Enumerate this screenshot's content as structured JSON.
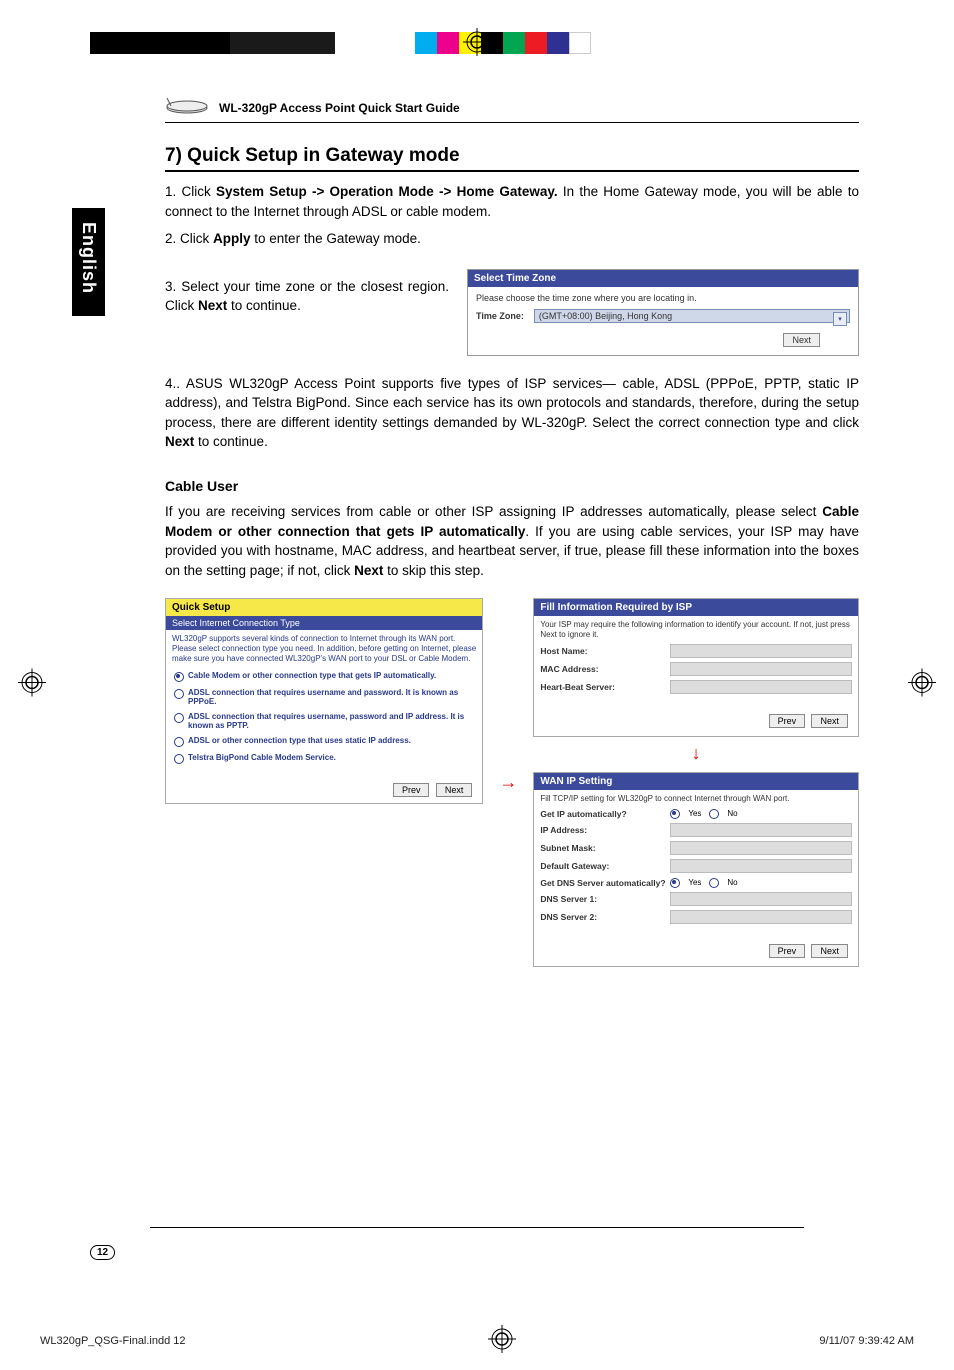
{
  "header": {
    "guide_title": "WL-320gP Access Point Quick Start Guide"
  },
  "side_tab": "English",
  "section_title": "7) Quick Setup in Gateway mode",
  "step1_prefix": "1. Click ",
  "step1_bold": "System Setup -> Operation Mode -> Home Gateway.",
  "step1_suffix": " In the Home Gateway mode, you will be able to connect to the Internet through ADSL or cable modem.",
  "step2_prefix": "2. Click ",
  "step2_bold": "Apply",
  "step2_suffix": " to enter the Gateway mode.",
  "step3_prefix": "3. Select your time zone or the closest region. Click ",
  "step3_bold": "Next",
  "step3_suffix": " to continue.",
  "tz_panel": {
    "title": "Select Time Zone",
    "desc": "Please choose the time zone where you are locating in.",
    "label": "Time Zone:",
    "value": "(GMT+08:00) Beijing, Hong Kong",
    "next": "Next"
  },
  "step4": "4.. ASUS WL320gP Access Point supports five types of ISP services— cable, ADSL (PPPoE, PPTP, static IP address), and Telstra BigPond. Since each service has its own protocols and standards, therefore, during the setup process, there are different identity settings demanded by WL-320gP. Select the correct connection type and click ",
  "step4_bold": "Next",
  "step4_suffix": " to continue.",
  "cable_heading": "Cable User",
  "cable_p_prefix": "If you are receiving services from cable or other ISP assigning IP addresses automatically, please select ",
  "cable_p_bold": "Cable Modem or other connection that gets IP automatically",
  "cable_p_mid": ". If you are using cable services, your ISP may have provided you with hostname, MAC address, and heartbeat server, if true, please fill these information into the boxes on the setting page; if not, click ",
  "cable_p_bold2": "Next",
  "cable_p_suffix": " to skip this step.",
  "quick_setup": {
    "title": "Quick Setup",
    "subtitle": "Select Internet Connection Type",
    "desc": "WL320gP supports several kinds of connection to Internet through its WAN port. Please select connection type you need. In addition, before getting on Internet, please make sure you have connected WL320gP's WAN port to your DSL or Cable Modem.",
    "options": [
      "Cable Modem or other connection type that gets IP automatically.",
      "ADSL connection that requires username and password. It is known as PPPoE.",
      "ADSL connection that requires username, password and IP address. It is known as PPTP.",
      "ADSL or other connection type that uses static IP address.",
      "Telstra BigPond Cable Modem Service."
    ],
    "prev": "Prev",
    "next": "Next"
  },
  "isp_info": {
    "title": "Fill Information Required by ISP",
    "desc": "Your ISP may require the following information to identify your account. If not, just press Next to ignore it.",
    "host": "Host Name:",
    "mac": "MAC Address:",
    "hb": "Heart-Beat Server:",
    "prev": "Prev",
    "next": "Next"
  },
  "wan": {
    "title": "WAN IP Setting",
    "desc": "Fill TCP/IP setting for WL320gP to connect Internet through WAN port.",
    "rows": {
      "get_ip": "Get IP automatically?",
      "ip": "IP Address:",
      "mask": "Subnet Mask:",
      "gw": "Default Gateway:",
      "get_dns": "Get DNS Server automatically?",
      "dns1": "DNS Server 1:",
      "dns2": "DNS Server 2:"
    },
    "yes": "Yes",
    "no": "No",
    "prev": "Prev",
    "next": "Next"
  },
  "page_number": "12",
  "footer": {
    "left": "WL320gP_QSG-Final.indd   12",
    "right": "9/11/07   9:39:42 AM"
  }
}
